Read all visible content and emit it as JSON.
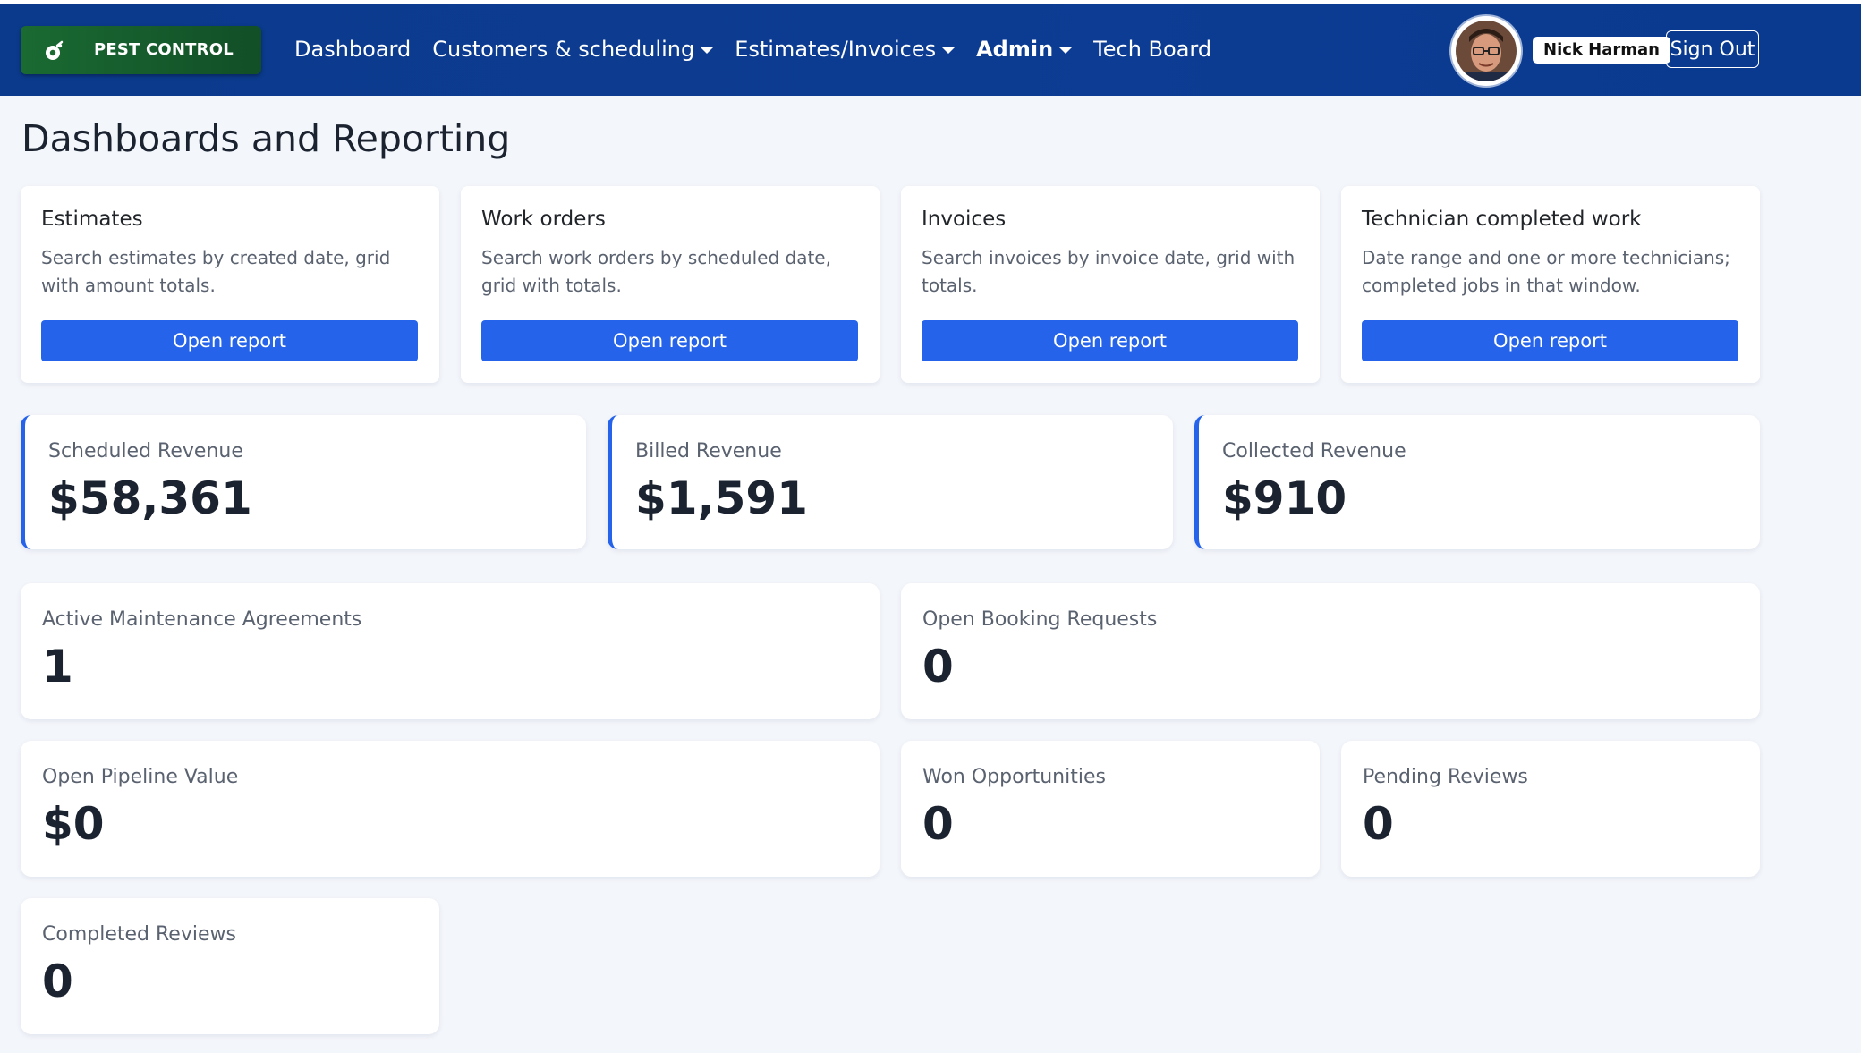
{
  "brand": {
    "name": "PEST CONTROL",
    "icon": "pest-control-logo-icon"
  },
  "nav": {
    "items": [
      {
        "label": "Dashboard",
        "dropdown": false,
        "bold": false
      },
      {
        "label": "Customers & scheduling",
        "dropdown": true,
        "bold": false
      },
      {
        "label": "Estimates/Invoices",
        "dropdown": true,
        "bold": false
      },
      {
        "label": "Admin",
        "dropdown": true,
        "bold": true
      },
      {
        "label": "Tech Board",
        "dropdown": false,
        "bold": false
      }
    ]
  },
  "user": {
    "name": "Nick Harman",
    "sign_out": "Sign Out"
  },
  "page": {
    "title": "Dashboards and Reporting"
  },
  "reports": [
    {
      "title": "Estimates",
      "description": "Search estimates by created date, grid with amount totals.",
      "button": "Open report"
    },
    {
      "title": "Work orders",
      "description": "Search work orders by scheduled date, grid with totals.",
      "button": "Open report"
    },
    {
      "title": "Invoices",
      "description": "Search invoices by invoice date, grid with totals.",
      "button": "Open report"
    },
    {
      "title": "Technician completed work",
      "description": "Date range and one or more technicians; completed jobs in that window.",
      "button": "Open report"
    }
  ],
  "revenue": [
    {
      "label": "Scheduled Revenue",
      "value": "$58,361"
    },
    {
      "label": "Billed Revenue",
      "value": "$1,591"
    },
    {
      "label": "Collected Revenue",
      "value": "$910"
    }
  ],
  "stats": [
    {
      "label": "Active Maintenance Agreements",
      "value": "1"
    },
    {
      "label": "Open Booking Requests",
      "value": "0"
    },
    {
      "label": "Open Pipeline Value",
      "value": "$0"
    },
    {
      "label": "Won Opportunities",
      "value": "0"
    },
    {
      "label": "Pending Reviews",
      "value": "0"
    },
    {
      "label": "Completed Reviews",
      "value": "0"
    }
  ],
  "colors": {
    "navbar": "#0c3c93",
    "brand_bg": "#1a6a32",
    "primary_button": "#2563eb",
    "page_bg": "#f3f6fb"
  }
}
